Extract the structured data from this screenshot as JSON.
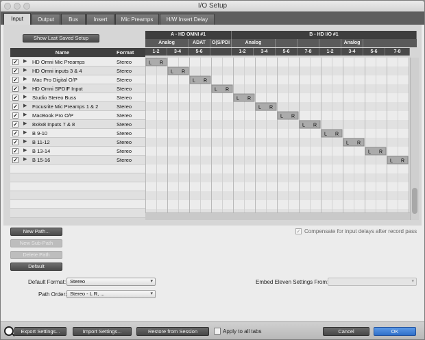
{
  "window": {
    "title": "I/O Setup"
  },
  "tabs": [
    {
      "label": "Input"
    },
    {
      "label": "Output"
    },
    {
      "label": "Bus"
    },
    {
      "label": "Insert"
    },
    {
      "label": "Mic Preamps"
    },
    {
      "label": "H/W Insert Delay"
    }
  ],
  "active_tab": "Input",
  "panel": {
    "show_last_saved_label": "Show Last Saved Setup",
    "col_name": "Name",
    "col_format": "Format",
    "devices": [
      {
        "label": "A - HD OMNI #1"
      },
      {
        "label": "B - HD I/O #1"
      }
    ],
    "subgroups": [
      {
        "label": "Analog"
      },
      {
        "label": "ADAT"
      },
      {
        "label": "O(S/PDI"
      },
      {
        "label": "Analog"
      },
      {
        "label": "Analog"
      }
    ],
    "channels": [
      "1-2",
      "3-4",
      "5-6",
      "",
      "1-2",
      "3-4",
      "5-6",
      "7-8",
      "1-2",
      "3-4",
      "5-6",
      "7-8"
    ],
    "lr_left": "L",
    "lr_right": "R",
    "paths": [
      {
        "name": "HD Omni Mic Preamps",
        "format": "Stereo",
        "checked": true
      },
      {
        "name": "HD Omni inputs 3 & 4",
        "format": "Stereo",
        "checked": true
      },
      {
        "name": "Mac Pro Digital O/P",
        "format": "Stereo",
        "checked": true
      },
      {
        "name": "HD Omni SPDIF Input",
        "format": "Stereo",
        "checked": true
      },
      {
        "name": "Studio Stereo Buss",
        "format": "Stereo",
        "checked": true
      },
      {
        "name": "Focusrite Mic Preamps 1 & 2",
        "format": "Stereo",
        "checked": true
      },
      {
        "name": "MacBook Pro O/P",
        "format": "Stereo",
        "checked": true
      },
      {
        "name": "8x8x8 Inputs 7 & 8",
        "format": "Stereo",
        "checked": true
      },
      {
        "name": "B 9-10",
        "format": "Stereo",
        "checked": true
      },
      {
        "name": "B 11-12",
        "format": "Stereo",
        "checked": true
      },
      {
        "name": "B 13-14",
        "format": "Stereo",
        "checked": true
      },
      {
        "name": "B 15-16",
        "format": "Stereo",
        "checked": true
      }
    ]
  },
  "controls": {
    "new_path": "New Path...",
    "new_sub_path": "New Sub-Path",
    "delete_path": "Delete Path",
    "default": "Default",
    "compensate_label": "Compensate for input delays after record pass",
    "compensate_checked": true,
    "default_format_label": "Default Format:",
    "default_format_value": "Stereo",
    "path_order_label": "Path Order:",
    "path_order_value": "Stereo - L R, ...",
    "embed_label": "Embed Eleven Settings From:",
    "embed_value": ""
  },
  "footer": {
    "export": "Export Settings...",
    "import": "Import Settings...",
    "restore": "Restore from Session",
    "apply_all": "Apply to all tabs",
    "cancel": "Cancel",
    "ok": "OK"
  },
  "colors": {
    "ok_button": "#3b7fd6",
    "grid_header": "#3e3e3e",
    "check_green": "#9bd13a"
  }
}
